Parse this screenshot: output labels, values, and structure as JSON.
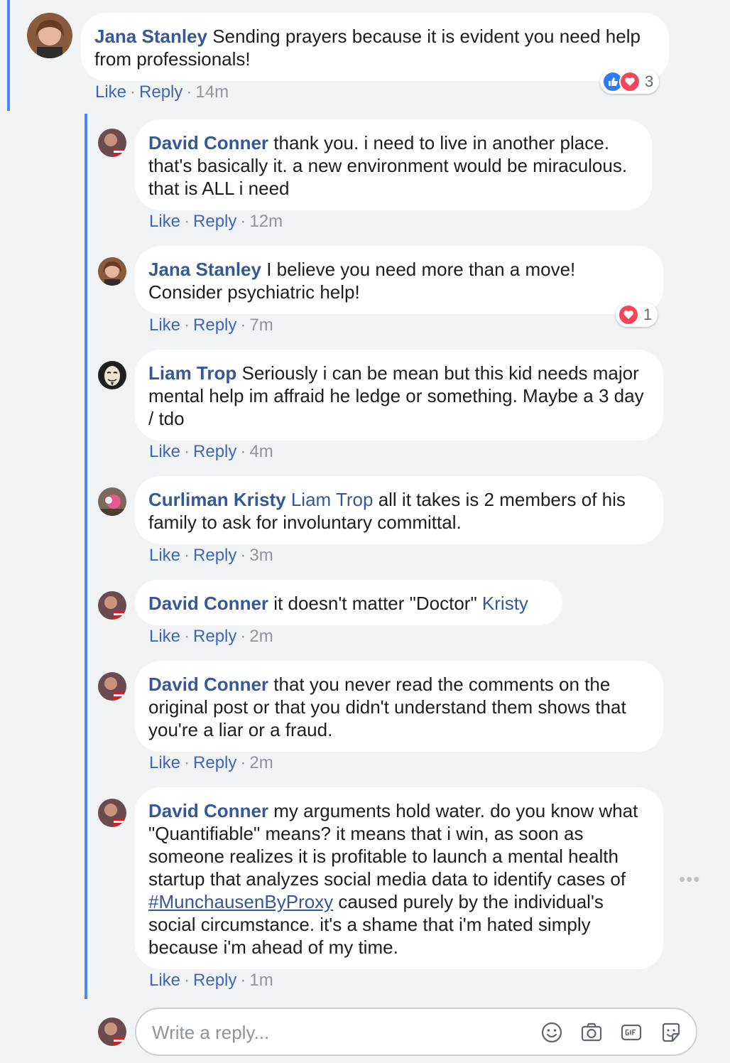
{
  "top_comment": {
    "author": "Jana Stanley",
    "text": "Sending prayers because it is evident you need help from professionals!",
    "like_label": "Like",
    "reply_label": "Reply",
    "time": "14m",
    "reaction_count": "3"
  },
  "replies": [
    {
      "author": "David Conner",
      "text": "thank you. i need to live in another place. that's basically it. a new environment would be miraculous. that is ALL i need",
      "like_label": "Like",
      "reply_label": "Reply",
      "time": "12m"
    },
    {
      "author": "Jana Stanley",
      "text": "I believe you need more than a move! Consider psychiatric help!",
      "like_label": "Like",
      "reply_label": "Reply",
      "time": "7m",
      "reaction_count": "1"
    },
    {
      "author": "Liam Trop",
      "text": "Seriously i can be mean but this kid needs major mental help im affraid he ledge or something. Maybe a 3 day / tdo",
      "like_label": "Like",
      "reply_label": "Reply",
      "time": "4m"
    },
    {
      "author": "Curliman Kristy",
      "tag": "Liam Trop",
      "text": "all it takes is 2 members of his family to ask for involuntary committal.",
      "like_label": "Like",
      "reply_label": "Reply",
      "time": "3m"
    },
    {
      "author": "David Conner",
      "text": "it doesn't matter \"Doctor\"",
      "tag": "Kristy",
      "like_label": "Like",
      "reply_label": "Reply",
      "time": "2m"
    },
    {
      "author": "David Conner",
      "text": "that you never read the comments on the original post or that you didn't understand them shows that you're a liar or a fraud.",
      "like_label": "Like",
      "reply_label": "Reply",
      "time": "2m"
    },
    {
      "author": "David Conner",
      "text_before": "my arguments hold water. do you know what \"Quantifiable\" means? it means that i win, as soon as someone realizes it is profitable to launch a mental health startup that analyzes social media data to identify cases of",
      "hash_symbol": "#",
      "hashtag": "MunchausenByProxy",
      "text_after": "caused purely by the individual's social circumstance. it's a shame that i'm hated simply because i'm ahead of my time.",
      "like_label": "Like",
      "reply_label": "Reply",
      "time": "1m",
      "more_label": "•••"
    }
  ],
  "composer": {
    "placeholder": "Write a reply..."
  },
  "icons": {
    "like": "thumbs-up-icon",
    "love": "heart-icon",
    "emoji": "smiley-icon",
    "camera": "camera-icon",
    "gif": "gif-icon",
    "sticker": "sticker-icon"
  },
  "colors": {
    "link": "#365899",
    "action": "#4267b2",
    "meta": "#90949c",
    "thread_bar": "#4b88f7",
    "like_blue": "#2e7bf6",
    "love_red": "#f2465b"
  }
}
